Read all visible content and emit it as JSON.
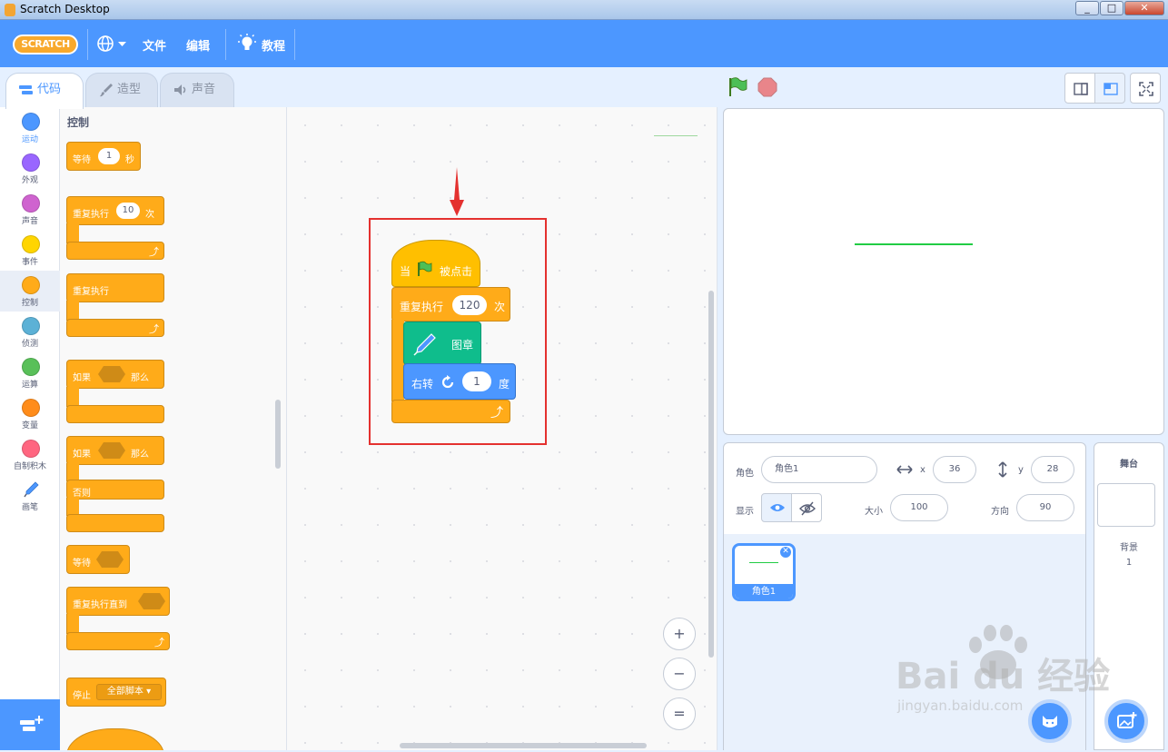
{
  "window": {
    "title": "Scratch Desktop"
  },
  "menubar": {
    "logo": "SCRATCH",
    "file": "文件",
    "edit": "编辑",
    "tutorials": "教程"
  },
  "tabs": [
    {
      "label": "代码"
    },
    {
      "label": "造型"
    },
    {
      "label": "声音"
    }
  ],
  "categories": [
    {
      "label": "运动",
      "color": "#4c97ff"
    },
    {
      "label": "外观",
      "color": "#9966ff"
    },
    {
      "label": "声音",
      "color": "#cf63cf"
    },
    {
      "label": "事件",
      "color": "#ffd500"
    },
    {
      "label": "控制",
      "color": "#ffab19"
    },
    {
      "label": "侦测",
      "color": "#5cb1d6"
    },
    {
      "label": "运算",
      "color": "#59c059"
    },
    {
      "label": "变量",
      "color": "#ff8c1a"
    },
    {
      "label": "自制积木",
      "color": "#ff6680"
    },
    {
      "label": "画笔",
      "color": "#0fbd8c"
    }
  ],
  "palette": {
    "title": "控制",
    "wait": {
      "label": "等待",
      "value": "1",
      "unit": "秒"
    },
    "repeat": {
      "label": "重复执行",
      "value": "10",
      "unit": "次"
    },
    "forever": {
      "label": "重复执行"
    },
    "if_then": {
      "label": "如果",
      "then": "那么"
    },
    "if_else": {
      "label": "如果",
      "then": "那么",
      "else": "否则"
    },
    "wait_until": {
      "label": "等待"
    },
    "repeat_until": {
      "label": "重复执行直到"
    },
    "stop": {
      "label": "停止",
      "option": "全部脚本 ▾"
    }
  },
  "script": {
    "when_flag": {
      "pre": "当",
      "post": "被点击"
    },
    "repeat": {
      "label": "重复执行",
      "value": "120",
      "unit": "次"
    },
    "stamp": {
      "label": "图章"
    },
    "turn": {
      "label": "右转",
      "value": "1",
      "unit": "度"
    }
  },
  "zoom": {
    "in": "+",
    "out": "−",
    "reset": "="
  },
  "sprite": {
    "label_sprite": "角色",
    "name": "角色1",
    "label_x": "x",
    "x": "36",
    "label_y": "y",
    "y": "28",
    "label_show": "显示",
    "label_size": "大小",
    "size": "100",
    "label_direction": "方向",
    "direction": "90",
    "thumb_name": "角色1"
  },
  "stage_panel": {
    "title": "舞台",
    "backdrops_label": "背景",
    "backdrops_count": "1"
  },
  "watermark": {
    "main": "Bai du 经验",
    "sub": "jingyan.baidu.com"
  },
  "colors": {
    "menubar": "#4c97ff",
    "control": "#ffab19",
    "events": "#ffbf00",
    "pen": "#0fbd8c",
    "motion": "#4c97ff",
    "highlight": "#e4312f",
    "stage_line": "#22cc44"
  }
}
